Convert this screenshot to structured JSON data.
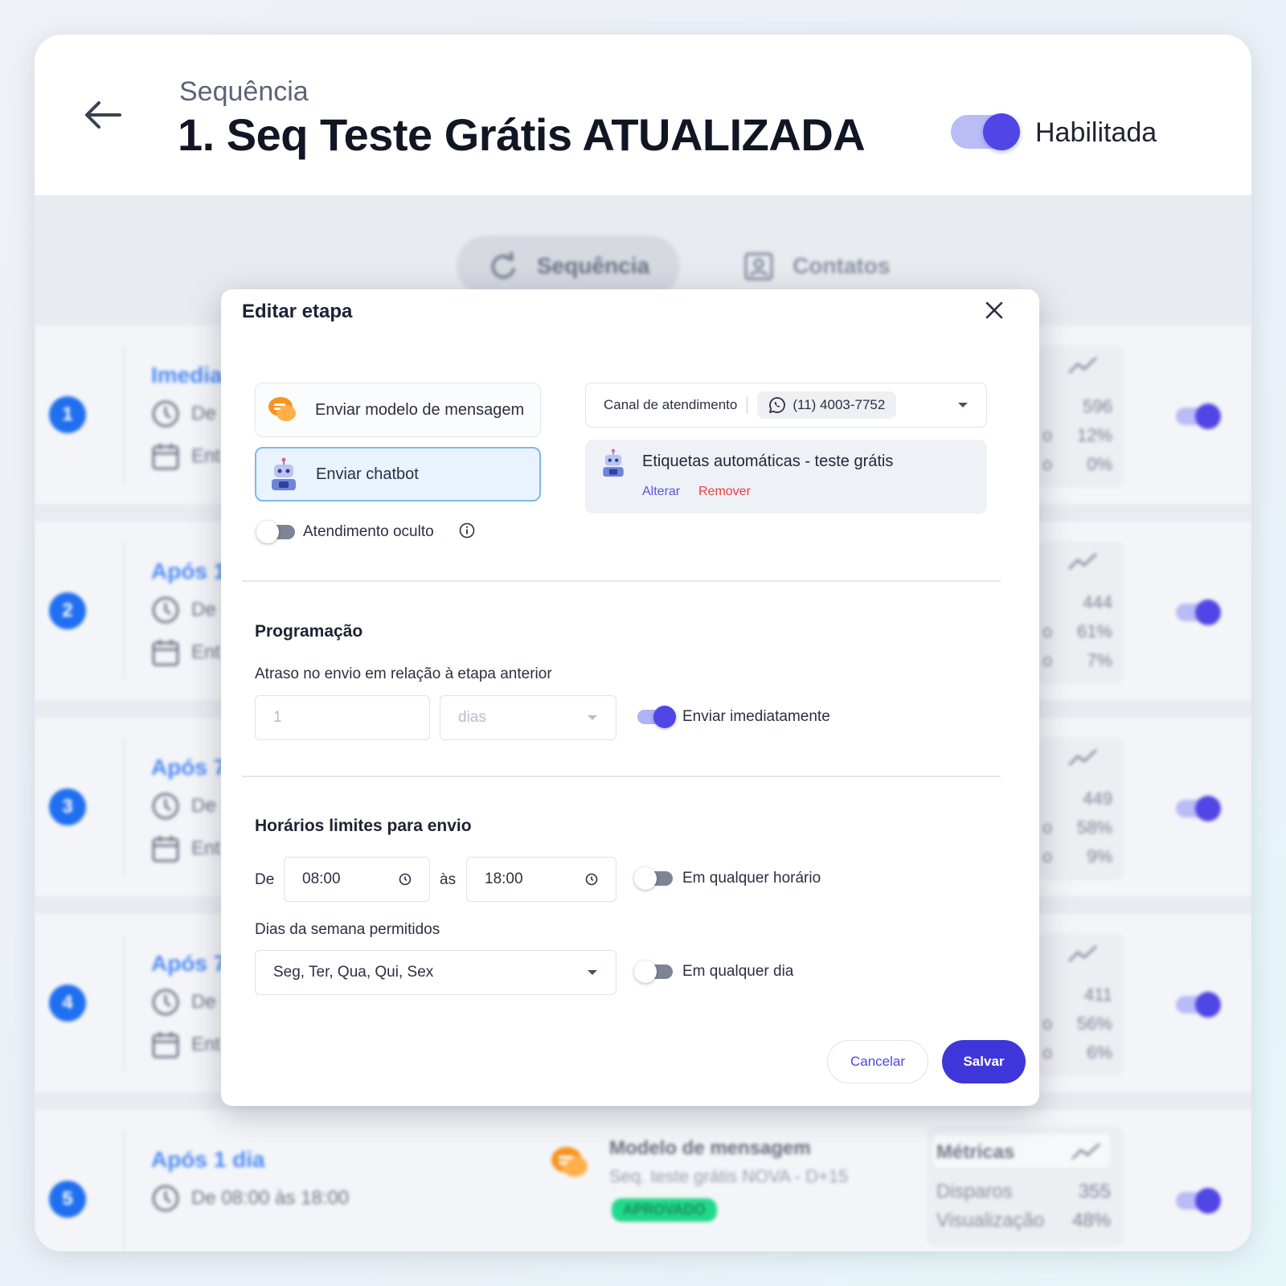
{
  "header": {
    "subtitle": "Sequência",
    "title": "1. Seq Teste Grátis ATUALIZADA",
    "enabled_label": "Habilitada",
    "enabled": true
  },
  "tabs": [
    {
      "label": "Sequência",
      "icon": "refresh-icon",
      "active": true
    },
    {
      "label": "Contatos",
      "icon": "contact-card-icon",
      "active": false
    }
  ],
  "steps": [
    {
      "number": "1",
      "when": "Imedia",
      "line1": "De",
      "line2": "Ent",
      "metrics": [
        "596",
        "12%",
        "0%"
      ],
      "metric_prefixes": [
        "",
        "o",
        "o"
      ]
    },
    {
      "number": "2",
      "when": "Após 1",
      "line1": "De",
      "line2": "Ent",
      "metrics": [
        "444",
        "61%",
        "7%"
      ],
      "metric_prefixes": [
        "",
        "o",
        "o"
      ]
    },
    {
      "number": "3",
      "when": "Após 7",
      "line1": "De",
      "line2": "Ent",
      "metrics": [
        "449",
        "58%",
        "9%"
      ],
      "metric_prefixes": [
        "",
        "o",
        "o"
      ]
    },
    {
      "number": "4",
      "when": "Após 7",
      "line1": "De",
      "line2": "Ent",
      "metrics": [
        "411",
        "56%",
        "6%"
      ],
      "metric_prefixes": [
        "",
        "o",
        "o"
      ]
    }
  ],
  "step5": {
    "number": "5",
    "when": "Após 1 dia",
    "schedule": "De 08:00 às 18:00",
    "message_type": "Modelo de mensagem",
    "message_name": "Seq. teste grátis NOVA - D+15",
    "badge": "APROVADO",
    "metrics_title": "Métricas",
    "metrics": [
      {
        "label": "Disparos",
        "value": "355"
      },
      {
        "label": "Visualização",
        "value": "48%"
      }
    ]
  },
  "modal": {
    "title": "Editar etapa",
    "send_template_label": "Enviar modelo de mensagem",
    "send_chatbot_label": "Enviar chatbot",
    "channel_label": "Canal de atendimento",
    "channel_phone": "(11) 4003-7752",
    "chatbot_name": "Etiquetas automáticas - teste grátis",
    "alterar": "Alterar",
    "remover": "Remover",
    "hidden_service_label": "Atendimento oculto",
    "schedule_title": "Programação",
    "delay_label": "Atraso no envio em relação à etapa anterior",
    "delay_value": "1",
    "delay_unit": "dias",
    "send_now_label": "Enviar imediatamente",
    "hours_title": "Horários limites para envio",
    "from_label": "De",
    "from_time": "08:00",
    "to_label": "às",
    "to_time": "18:00",
    "any_time_label": "Em qualquer horário",
    "weekdays_label": "Dias da semana permitidos",
    "weekdays_value": "Seg, Ter, Qua, Qui, Sex",
    "any_day_label": "Em qualquer dia",
    "cancel_label": "Cancelar",
    "save_label": "Salvar"
  },
  "colors": {
    "accent": "#4f46e5",
    "step_blue": "#1f6ff0",
    "danger": "#ef3b3b",
    "approved": "#20d98a"
  }
}
